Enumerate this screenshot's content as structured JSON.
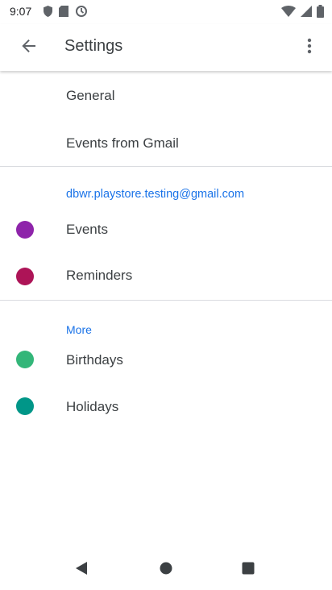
{
  "status_bar": {
    "time": "9:07"
  },
  "app_bar": {
    "title": "Settings"
  },
  "items": {
    "general": "General",
    "events_from_gmail": "Events from Gmail",
    "account_email": "dbwr.playstore.testing@gmail.com",
    "events": "Events",
    "reminders": "Reminders",
    "more_header": "More",
    "birthdays": "Birthdays",
    "holidays": "Holidays"
  },
  "colors": {
    "accent": "#1a73e8",
    "events_dot": "#8e24aa",
    "reminders_dot": "#ad1457",
    "birthdays_dot": "#33b679",
    "holidays_dot": "#009688"
  }
}
